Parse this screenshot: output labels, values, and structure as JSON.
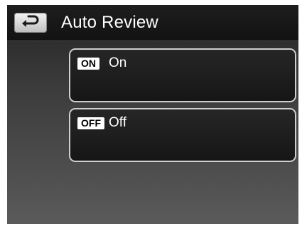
{
  "header": {
    "title": "Auto Review",
    "back_icon": "return-arrow-icon"
  },
  "options": [
    {
      "badge": "ON",
      "label": "On"
    },
    {
      "badge": "OFF",
      "label": "Off"
    }
  ],
  "colors": {
    "background": "#3a3a3a",
    "header_background": "#181818",
    "option_border": "#cfcfcf",
    "text": "#ffffff"
  }
}
